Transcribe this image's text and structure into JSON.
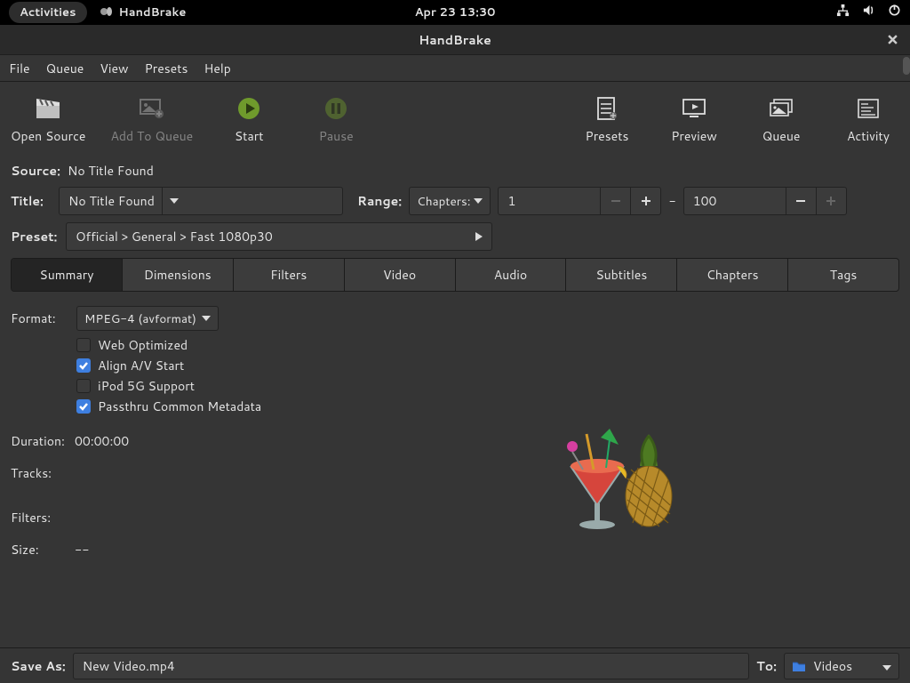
{
  "topbar": {
    "activities": "Activities",
    "app_name": "HandBrake",
    "datetime": "Apr 23  13:30"
  },
  "window": {
    "title": "HandBrake"
  },
  "menu": {
    "file": "File",
    "queue": "Queue",
    "view": "View",
    "presets": "Presets",
    "help": "Help"
  },
  "toolbar": {
    "open_source": "Open Source",
    "add_to_queue": "Add To Queue",
    "start": "Start",
    "pause": "Pause",
    "presets": "Presets",
    "preview": "Preview",
    "queue": "Queue",
    "activity": "Activity"
  },
  "source": {
    "label": "Source:",
    "value": "No Title Found"
  },
  "title": {
    "label": "Title:",
    "value": "No Title Found"
  },
  "range": {
    "label": "Range:",
    "mode": "Chapters:",
    "start": "1",
    "dash": "-",
    "end": "100"
  },
  "preset": {
    "label": "Preset:",
    "value": "Official > General > Fast 1080p30"
  },
  "tabs": [
    "Summary",
    "Dimensions",
    "Filters",
    "Video",
    "Audio",
    "Subtitles",
    "Chapters",
    "Tags"
  ],
  "summary": {
    "format_label": "Format:",
    "format_value": "MPEG-4 (avformat)",
    "checks": {
      "web_optimized": {
        "label": "Web Optimized",
        "checked": false
      },
      "align_av": {
        "label": "Align A/V Start",
        "checked": true
      },
      "ipod5g": {
        "label": "iPod 5G Support",
        "checked": false
      },
      "passthru_meta": {
        "label": "Passthru Common Metadata",
        "checked": true
      }
    },
    "duration_label": "Duration:",
    "duration_value": "00:00:00",
    "tracks_label": "Tracks:",
    "filters_label": "Filters:",
    "size_label": "Size:",
    "size_value": "--"
  },
  "save": {
    "label": "Save As:",
    "filename": "New Video.mp4",
    "to_label": "To:",
    "folder": "Videos"
  }
}
